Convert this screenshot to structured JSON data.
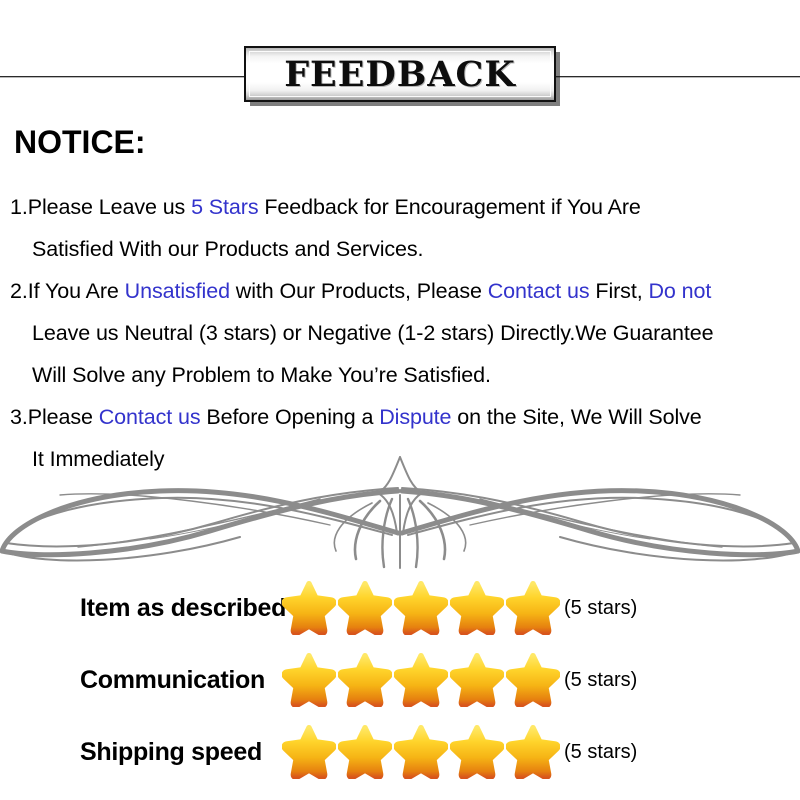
{
  "banner": {
    "title": "FEEDBACK"
  },
  "notice": {
    "heading": "NOTICE:",
    "lines": [
      {
        "indent": false,
        "segments": [
          {
            "text": "1.Please Leave us  ",
            "highlight": false
          },
          {
            "text": "5 Stars",
            "highlight": true
          },
          {
            "text": "  Feedback for  Encouragement  if You Are",
            "highlight": false
          }
        ]
      },
      {
        "indent": true,
        "segments": [
          {
            "text": "Satisfied With our Products and Services.",
            "highlight": false
          }
        ]
      },
      {
        "indent": false,
        "segments": [
          {
            "text": "2.If You Are ",
            "highlight": false
          },
          {
            "text": "Unsatisfied",
            "highlight": true
          },
          {
            "text": " with Our Products, Please ",
            "highlight": false
          },
          {
            "text": "Contact us",
            "highlight": true
          },
          {
            "text": " First, ",
            "highlight": false
          },
          {
            "text": "Do not",
            "highlight": true
          }
        ]
      },
      {
        "indent": true,
        "segments": [
          {
            "text": "Leave us Neutral (3 stars) or Negative (1-2 stars) Directly.We Guarantee",
            "highlight": false
          }
        ]
      },
      {
        "indent": true,
        "segments": [
          {
            "text": "Will Solve any Problem to Make You’re  Satisfied.",
            "highlight": false
          }
        ]
      },
      {
        "indent": false,
        "segments": [
          {
            "text": "3.Please ",
            "highlight": false
          },
          {
            "text": "Contact us",
            "highlight": true
          },
          {
            "text": " Before Opening a ",
            "highlight": false
          },
          {
            "text": "Dispute",
            "highlight": true
          },
          {
            "text": " on the Site, We Will Solve",
            "highlight": false
          }
        ]
      },
      {
        "indent": true,
        "segments": [
          {
            "text": "It Immediately",
            "highlight": false
          }
        ]
      }
    ]
  },
  "ratings": {
    "rows": [
      {
        "label": "Item as described",
        "stars": 5,
        "count_text": "(5 stars)"
      },
      {
        "label": "Communication",
        "stars": 5,
        "count_text": "(5 stars)"
      },
      {
        "label": "Shipping speed",
        "stars": 5,
        "count_text": "(5 stars)"
      }
    ]
  },
  "colors": {
    "highlight": "#3333cc",
    "star_top": "#ffe14d",
    "star_mid": "#fbc31a",
    "star_bottom": "#e07a10",
    "star_shadow": "#d2442a",
    "ornament": "#8c8c8c",
    "text": "#000000"
  }
}
